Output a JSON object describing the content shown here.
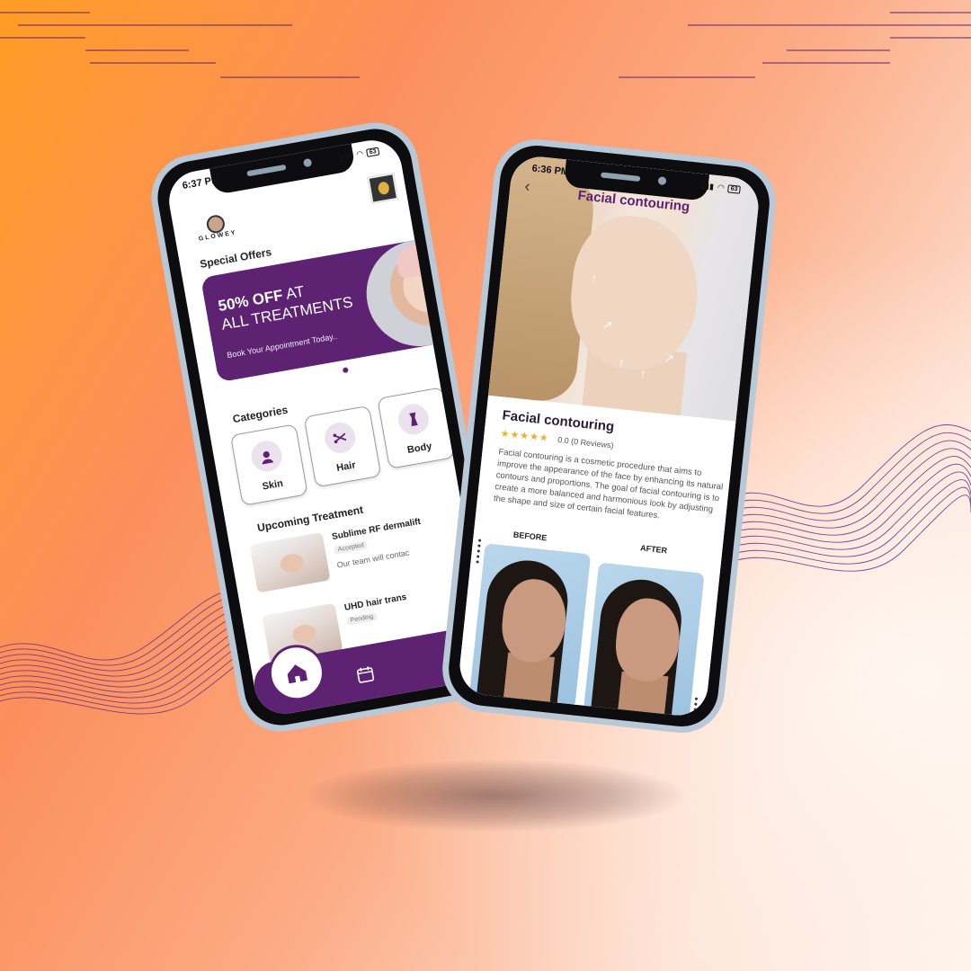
{
  "phone1": {
    "status_time": "6:37 PM",
    "battery": "63",
    "logo_text": "GLOWEY",
    "special_offers_title": "Special Offers",
    "offer": {
      "headline_bold": "50% OFF",
      "headline_rest": " AT",
      "headline_line2": "ALL TREATMENTS",
      "subtext": "Book Your Appointment Today.."
    },
    "categories_title": "Categories",
    "categories": [
      {
        "label": "Skin",
        "icon": "woman-face-icon"
      },
      {
        "label": "Hair",
        "icon": "hair-scissors-icon"
      },
      {
        "label": "Body",
        "icon": "body-figure-icon"
      }
    ],
    "upcoming_title": "Upcoming Treatment",
    "treatments": [
      {
        "name": "Sublime RF dermalift",
        "status": "Accepted",
        "note": "Our team will contac"
      },
      {
        "name": "UHD hair trans",
        "status": "Pending",
        "note": ""
      }
    ],
    "nav": {
      "home_icon": "home-icon",
      "calendar_icon": "calendar-icon"
    }
  },
  "phone2": {
    "status_time": "6:36 PM",
    "battery": "63",
    "header_title": "Facial contouring",
    "title": "Facial contouring",
    "stars": "★★★★★",
    "reviews": "0.0 (0 Reviews)",
    "description": "Facial contouring is a cosmetic procedure that aims to improve the appearance of the face by enhancing its natural contours and proportions. The goal of facial contouring is to create a more balanced and harmonious look by adjusting the shape and size of certain facial features.",
    "before_label": "BEFORE",
    "after_label": "AFTER"
  },
  "colors": {
    "brand_purple": "#5e2273",
    "star_gold": "#f2b01e",
    "phone_frame": "#b9c8d6"
  }
}
